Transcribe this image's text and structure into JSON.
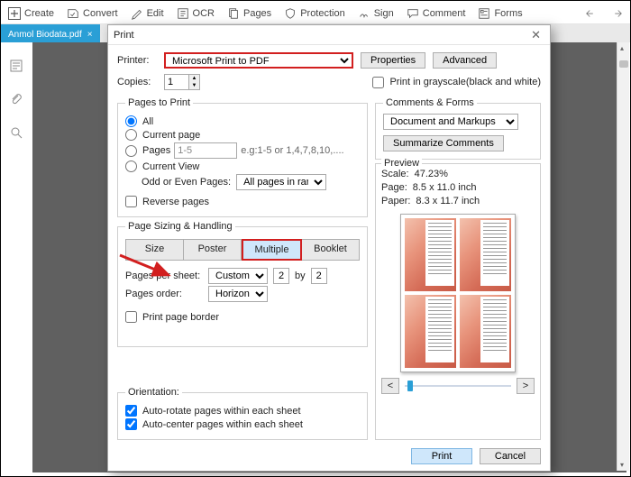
{
  "toolbar": {
    "items": [
      "Create",
      "Convert",
      "Edit",
      "OCR",
      "Pages",
      "Protection",
      "Sign",
      "Comment",
      "Forms"
    ]
  },
  "tab": {
    "filename": "Anmol Biodata.pdf"
  },
  "dialog": {
    "title": "Print",
    "printer_label": "Printer:",
    "printer_value": "Microsoft Print to PDF",
    "properties": "Properties",
    "advanced": "Advanced",
    "copies_label": "Copies:",
    "copies_value": "1",
    "grayscale": "Print in grayscale(black and white)",
    "pages_to_print": {
      "legend": "Pages to Print",
      "all": "All",
      "current_page": "Current page",
      "pages": "Pages",
      "pages_value": "1-5",
      "pages_hint": "e.g:1-5 or 1,4,7,8,10,....",
      "current_view": "Current View",
      "odd_even_label": "Odd or Even Pages:",
      "odd_even_value": "All pages in range",
      "reverse": "Reverse pages"
    },
    "sizing": {
      "legend": "Page Sizing & Handling",
      "tabs": {
        "size": "Size",
        "poster": "Poster",
        "multiple": "Multiple",
        "booklet": "Booklet"
      },
      "pages_per_sheet": "Pages per sheet:",
      "pps_select": "Custom Sc",
      "pps_cols": "2",
      "pps_by": "by",
      "pps_rows": "2",
      "pages_order": "Pages order:",
      "order_value": "Horizontal",
      "border": "Print page border"
    },
    "orientation": {
      "legend": "Orientation:",
      "auto_rotate": "Auto-rotate pages within each sheet",
      "auto_center": "Auto-center pages within each sheet"
    },
    "comments": {
      "legend": "Comments & Forms",
      "value": "Document and Markups",
      "summarize": "Summarize Comments"
    },
    "preview": {
      "legend": "Preview",
      "scale_label": "Scale:",
      "scale": "47.23%",
      "page_label": "Page:",
      "page": "8.5 x 11.0 inch",
      "paper_label": "Paper:",
      "paper": "8.3 x 11.7 inch"
    },
    "footer": {
      "print": "Print",
      "cancel": "Cancel"
    }
  }
}
